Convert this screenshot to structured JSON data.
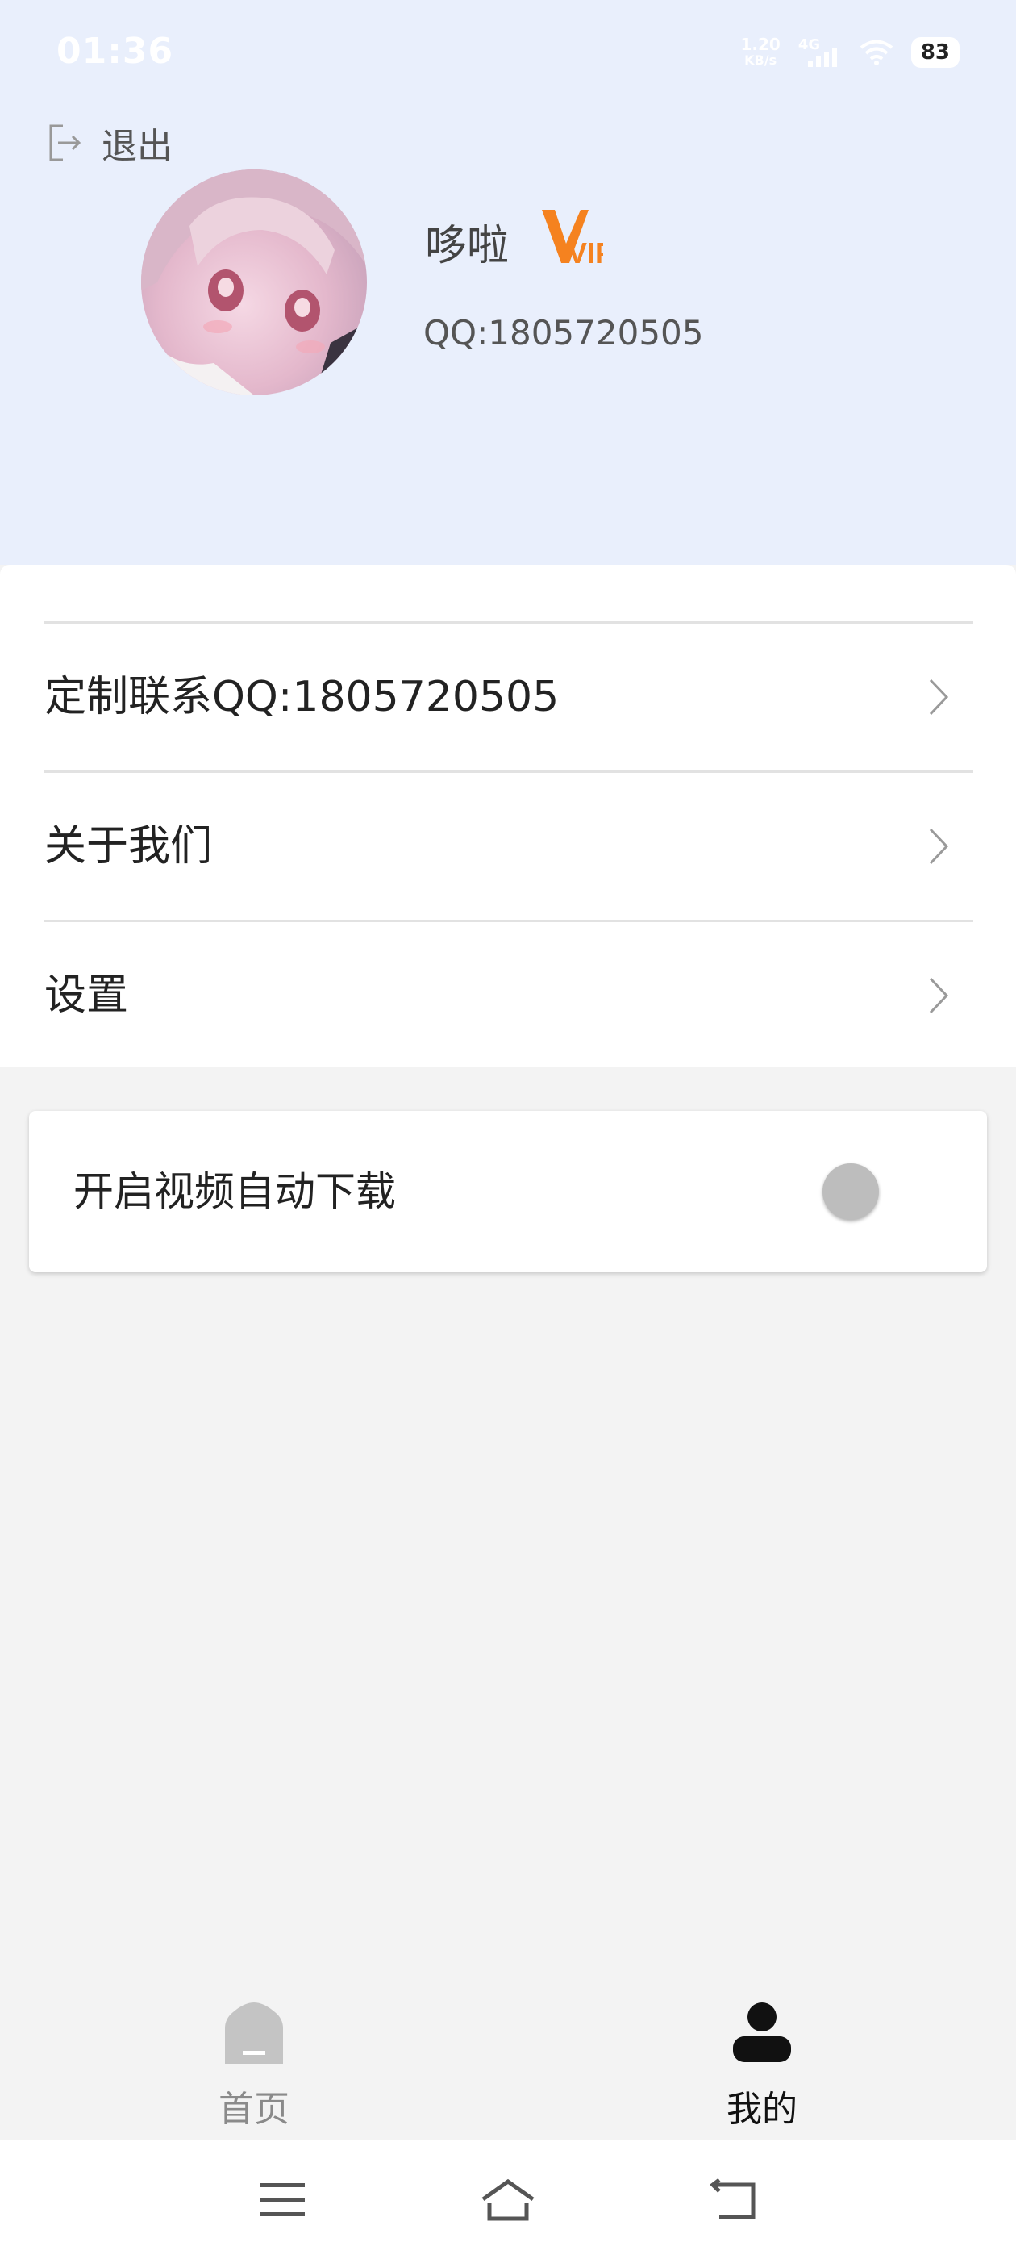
{
  "status_bar": {
    "time": "01:36",
    "net_speed_value": "1.20",
    "net_speed_unit": "KB/s",
    "network_type": "4G",
    "battery": "83"
  },
  "header": {
    "logout_label": "退出",
    "username": "哆啦",
    "vip_badge": "VIP",
    "qq": "QQ:1805720505"
  },
  "menu": {
    "items": [
      {
        "label": "定制联系QQ:1805720505"
      },
      {
        "label": "关于我们"
      },
      {
        "label": "设置"
      }
    ]
  },
  "settings_card": {
    "auto_download_label": "开启视频自动下载",
    "auto_download_enabled": false
  },
  "bottom_nav": {
    "tabs": [
      {
        "label": "首页",
        "icon": "home-icon",
        "active": false
      },
      {
        "label": "我的",
        "icon": "user-icon",
        "active": true
      }
    ]
  },
  "colors": {
    "header_bg": "#e9effc",
    "vip_orange": "#f5821f",
    "page_bg": "#f3f3f3"
  }
}
